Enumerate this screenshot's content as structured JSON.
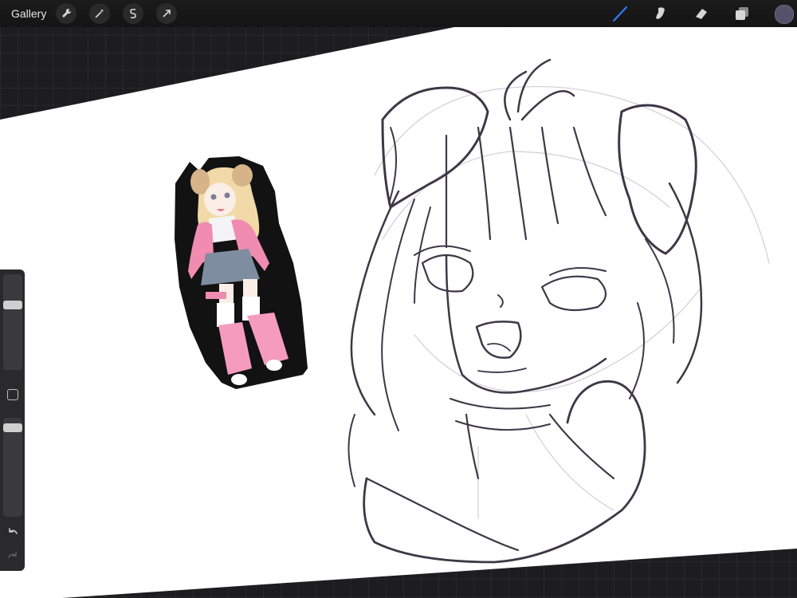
{
  "toolbar": {
    "gallery_label": "Gallery",
    "left_tools": [
      "wrench-icon",
      "magic-wand-icon",
      "selection-icon",
      "transform-arrow-icon"
    ],
    "right_tools": [
      "brush-icon",
      "smudge-icon",
      "eraser-icon",
      "layers-icon"
    ],
    "active_tool": "brush-icon",
    "active_color": "#56516a",
    "accent_color": "#2d7bf6"
  },
  "sidebar": {
    "brush_size_level": 0.7,
    "opacity_level": 0.94,
    "controls": [
      "brush-size-slider",
      "modify-button",
      "opacity-slider",
      "undo-arrow-icon",
      "redo-arrow-icon"
    ]
  },
  "canvas": {
    "background_color": "#ffffff",
    "content": [
      "reference-character-image",
      "head-sketch"
    ]
  }
}
